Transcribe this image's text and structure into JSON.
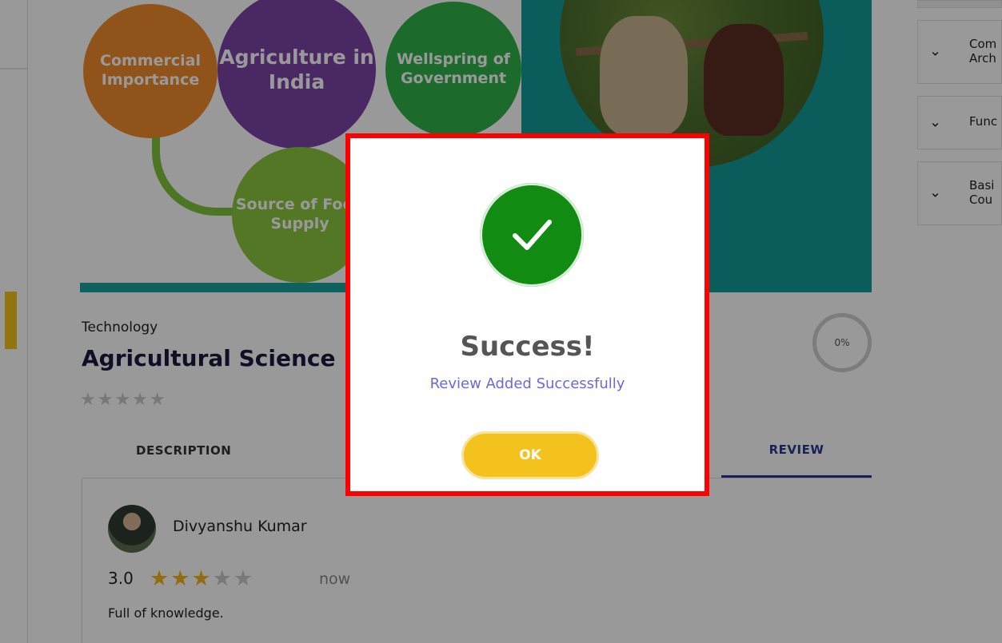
{
  "banner": {
    "circle_commercial": "Commercial Importance",
    "circle_india": "Agriculture in India",
    "circle_government": "Wellspring of Government",
    "circle_food": "Source of Food Supply"
  },
  "course": {
    "category": "Technology",
    "title": "Agricultural Science",
    "rating_stars": "★★★★★",
    "progress": "0%"
  },
  "tabs": {
    "description": "DESCRIPTION",
    "review": "REVIEW"
  },
  "review": {
    "reviewer": "Divyanshu Kumar",
    "score": "3.0",
    "stars_on": "★★★",
    "stars_off": "★★",
    "time": "now",
    "text": "Full of knowledge."
  },
  "sidebar": {
    "items": [
      {
        "label": "Com\nArch"
      },
      {
        "label": "Func"
      },
      {
        "label": "Basi\nCou"
      }
    ],
    "chevron": "⌄"
  },
  "modal": {
    "title": "Success!",
    "message": "Review Added Successfully",
    "ok_label": "OK"
  },
  "colors": {
    "success_green": "#118b11",
    "ok_yellow": "#f3c21c",
    "frame_red": "#ff0000",
    "message_blue": "#6a6ad6"
  },
  "icons": {
    "success": "check-circle-icon",
    "chevron": "chevron-down-icon",
    "star": "star-icon"
  }
}
